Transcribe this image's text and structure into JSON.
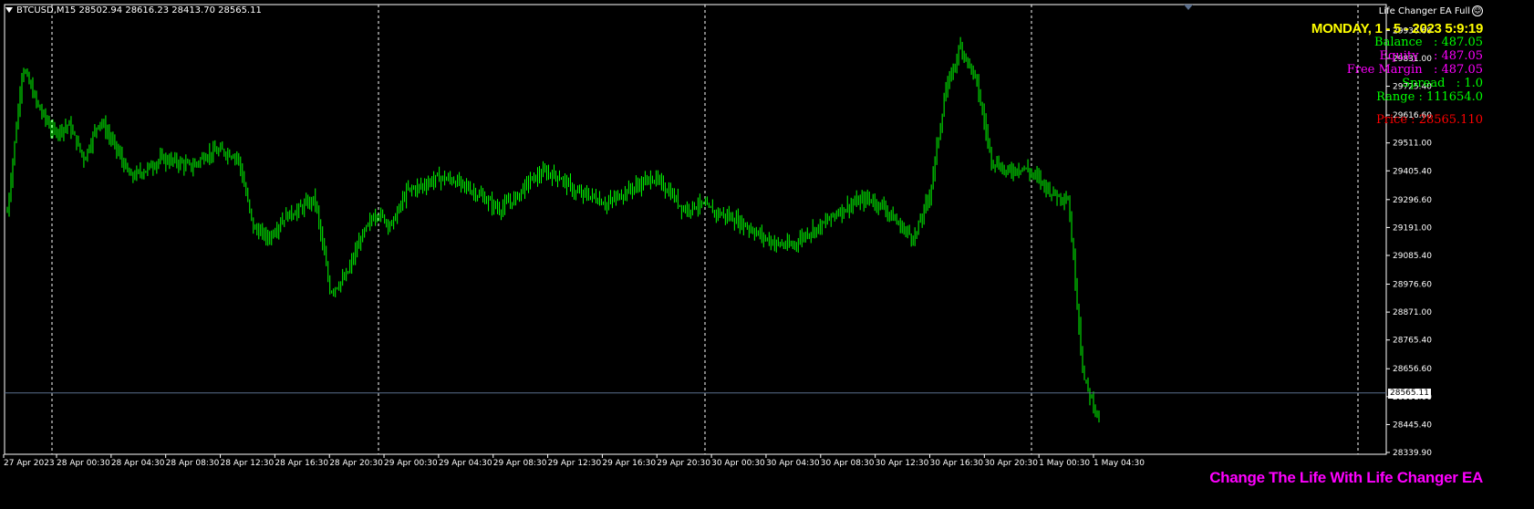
{
  "header": {
    "symbol_info": "BTCUSD,M15  28502.94 28616.23 28413.70 28565.11",
    "ea_label": "Life Changer EA  Full",
    "ea_icon": "smiley-icon"
  },
  "info_panel": {
    "date": "MONDAY, 1 - 5 - 2023 5:9:19",
    "rows": [
      {
        "label": "Balance   : ",
        "value": "487.05",
        "color": "#00ff00"
      },
      {
        "label": "Equity    : ",
        "value": "487.05",
        "color": "#ff00ff"
      },
      {
        "label": "Free Margin   : ",
        "value": "487.05",
        "color": "#ff00ff"
      },
      {
        "label": "Spread   : ",
        "value": "1.0",
        "color": "#00ff00"
      },
      {
        "label": "Range : ",
        "value": "111654.0",
        "color": "#00ff00"
      }
    ],
    "price_label": "Price : ",
    "price_value": "28565.110",
    "price_color": "#ff0000"
  },
  "footer": {
    "brand": "Change The Life With Life Changer EA"
  },
  "colors": {
    "candle": "#00ff00",
    "grid": "#ffffff",
    "price_line": "#5a6e8c",
    "axis_text": "#ffffff"
  },
  "current_price": "28565.11",
  "chart_data": {
    "type": "line",
    "symbol": "BTCUSD",
    "timeframe": "M15",
    "ylim": [
      28339.9,
      30000
    ],
    "y_ticks": [
      "29936.60",
      "29831.00",
      "29725.40",
      "29616.60",
      "29511.00",
      "29405.40",
      "29296.60",
      "29191.00",
      "29085.40",
      "28976.60",
      "28871.00",
      "28765.40",
      "28656.60",
      "28551.00",
      "28445.40",
      "28339.90"
    ],
    "x_ticks": [
      "27 Apr 2023",
      "28 Apr 00:30",
      "28 Apr 04:30",
      "28 Apr 08:30",
      "28 Apr 12:30",
      "28 Apr 16:30",
      "28 Apr 20:30",
      "29 Apr 00:30",
      "29 Apr 04:30",
      "29 Apr 08:30",
      "29 Apr 12:30",
      "29 Apr 16:30",
      "29 Apr 20:30",
      "30 Apr 00:30",
      "30 Apr 04:30",
      "30 Apr 08:30",
      "30 Apr 12:30",
      "30 Apr 16:30",
      "30 Apr 20:30",
      "1 May 00:30",
      "1 May 04:30"
    ],
    "series": [
      {
        "values": [
          29250,
          29800,
          29650,
          29550,
          29580,
          29450,
          29600,
          29500,
          29380,
          29410,
          29450,
          29440,
          29420,
          29470,
          29480,
          29460,
          29190,
          29150,
          29230,
          29260,
          29300,
          28950,
          29000,
          29150,
          29250,
          29200,
          29330,
          29350,
          29380,
          29370,
          29340,
          29300,
          29260,
          29300,
          29370,
          29400,
          29380,
          29320,
          29310,
          29280,
          29320,
          29350,
          29380,
          29330,
          29260,
          29280,
          29250,
          29230,
          29200,
          29160,
          29130,
          29120,
          29170,
          29200,
          29250,
          29280,
          29300,
          29270,
          29200,
          29150,
          29320,
          29700,
          29880,
          29750,
          29450,
          29400,
          29420,
          29380,
          29320,
          29300,
          28620,
          28470
        ]
      }
    ]
  }
}
